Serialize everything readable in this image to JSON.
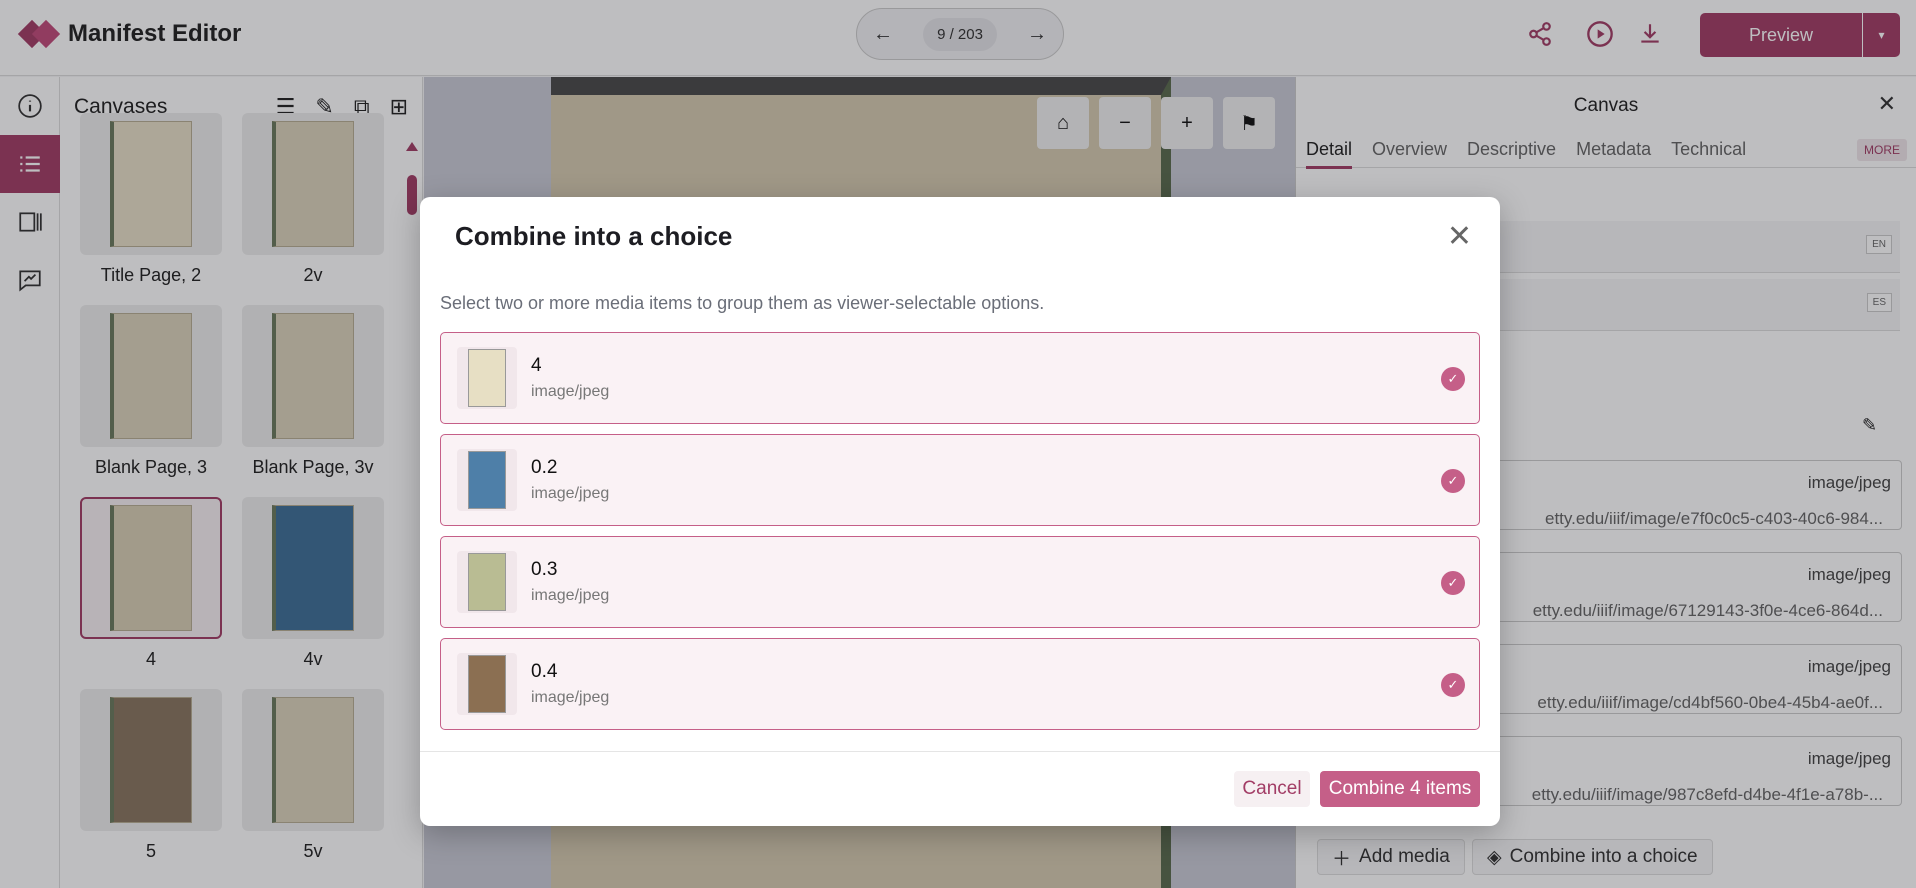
{
  "app": {
    "title": "Manifest Editor"
  },
  "pager": {
    "prev": "←",
    "count": "9 / 203",
    "next": "→"
  },
  "toolbar": {
    "share_icon": "share-icon",
    "play_icon": "play-icon",
    "download_icon": "download-icon",
    "preview_label": "Preview",
    "preview_dropdown": "▾"
  },
  "rail": {
    "items": [
      "info-icon",
      "list-icon",
      "panel-icon",
      "annotate-icon"
    ],
    "active_index": 1
  },
  "sidebar": {
    "title": "Canvases",
    "thumbnails": [
      {
        "label": "Title Page, 2"
      },
      {
        "label": "2v"
      },
      {
        "label": "Blank Page, 3"
      },
      {
        "label": "Blank Page, 3v"
      },
      {
        "label": "4",
        "selected": true
      },
      {
        "label": "4v"
      },
      {
        "label": "5"
      },
      {
        "label": "5v"
      }
    ]
  },
  "viewer": {
    "home": "⌂",
    "zoom_out": "−",
    "zoom_in": "+",
    "flag": "⚑"
  },
  "panel": {
    "title": "Canvas",
    "close": "✕",
    "tabs": [
      "Detail",
      "Overview",
      "Descriptive",
      "Metadata",
      "Technical"
    ],
    "active_tab": "Detail",
    "more": "MORE",
    "label_langs": [
      "EN",
      "ES"
    ],
    "media": [
      {
        "type": "image/jpeg",
        "url": "etty.edu/iiif/image/e7f0c0c5-c403-40c6-984..."
      },
      {
        "type": "image/jpeg",
        "url": "etty.edu/iiif/image/67129143-3f0e-4ce6-864d..."
      },
      {
        "type": "image/jpeg",
        "url": "etty.edu/iiif/image/cd4bf560-0be4-45b4-ae0f..."
      },
      {
        "type": "image/jpeg",
        "url": "etty.edu/iiif/image/987c8efd-d4be-4f1e-a78b-..."
      }
    ],
    "add_media": "Add media",
    "combine_choice": "Combine into a choice"
  },
  "modal": {
    "title": "Combine into a choice",
    "close": "✕",
    "description": "Select two or more media items to group them as viewer-selectable options.",
    "items": [
      {
        "name": "4",
        "mime": "image/jpeg",
        "checked": true,
        "thumb_color": "#e7dfc4"
      },
      {
        "name": "0.2",
        "mime": "image/jpeg",
        "checked": true,
        "thumb_color": "#4e7fa8"
      },
      {
        "name": "0.3",
        "mime": "image/jpeg",
        "checked": true,
        "thumb_color": "#b9bc93"
      },
      {
        "name": "0.4",
        "mime": "image/jpeg",
        "checked": true,
        "thumb_color": "#8b6f52"
      }
    ],
    "cancel_label": "Cancel",
    "confirm_label": "Combine 4 items"
  }
}
